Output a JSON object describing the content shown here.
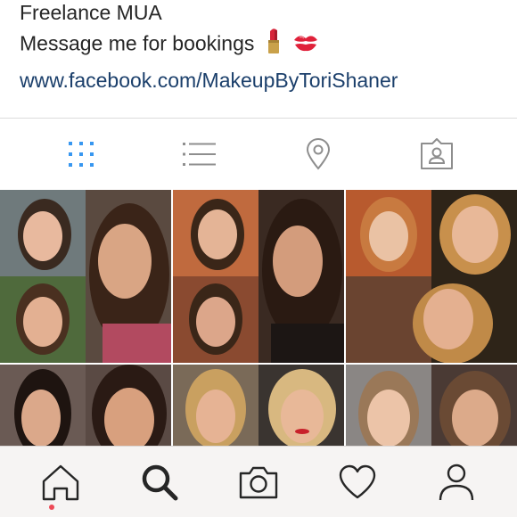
{
  "profile": {
    "bio_title": "Freelance MUA",
    "bio_message": "Message me for bookings",
    "website": "www.facebook.com/MakeupByToriShaner"
  },
  "tabs": [
    {
      "name": "grid-view",
      "icon": "grid-icon",
      "active": true
    },
    {
      "name": "list-view",
      "icon": "list-icon",
      "active": false
    },
    {
      "name": "map-view",
      "icon": "location-pin-icon",
      "active": false
    },
    {
      "name": "tagged-view",
      "icon": "tagged-person-icon",
      "active": false
    }
  ],
  "posts": [
    {
      "id": "post-1",
      "type": "before-after"
    },
    {
      "id": "post-2",
      "type": "before-after"
    },
    {
      "id": "post-3",
      "type": "before-after"
    },
    {
      "id": "post-4",
      "type": "before-after"
    },
    {
      "id": "post-5",
      "type": "before-after"
    },
    {
      "id": "post-6",
      "type": "before-after"
    }
  ],
  "bottom_nav": [
    {
      "name": "home",
      "icon": "home-icon",
      "active": true
    },
    {
      "name": "search",
      "icon": "search-icon",
      "active": false
    },
    {
      "name": "camera",
      "icon": "camera-icon",
      "active": false
    },
    {
      "name": "activity",
      "icon": "heart-icon",
      "active": false
    },
    {
      "name": "profile",
      "icon": "profile-icon",
      "active": false
    }
  ],
  "colors": {
    "link": "#1b3f6b",
    "active_tab": "#3897f0",
    "notification_dot": "#ed4956",
    "bottom_bar": "#f6f4f3"
  }
}
